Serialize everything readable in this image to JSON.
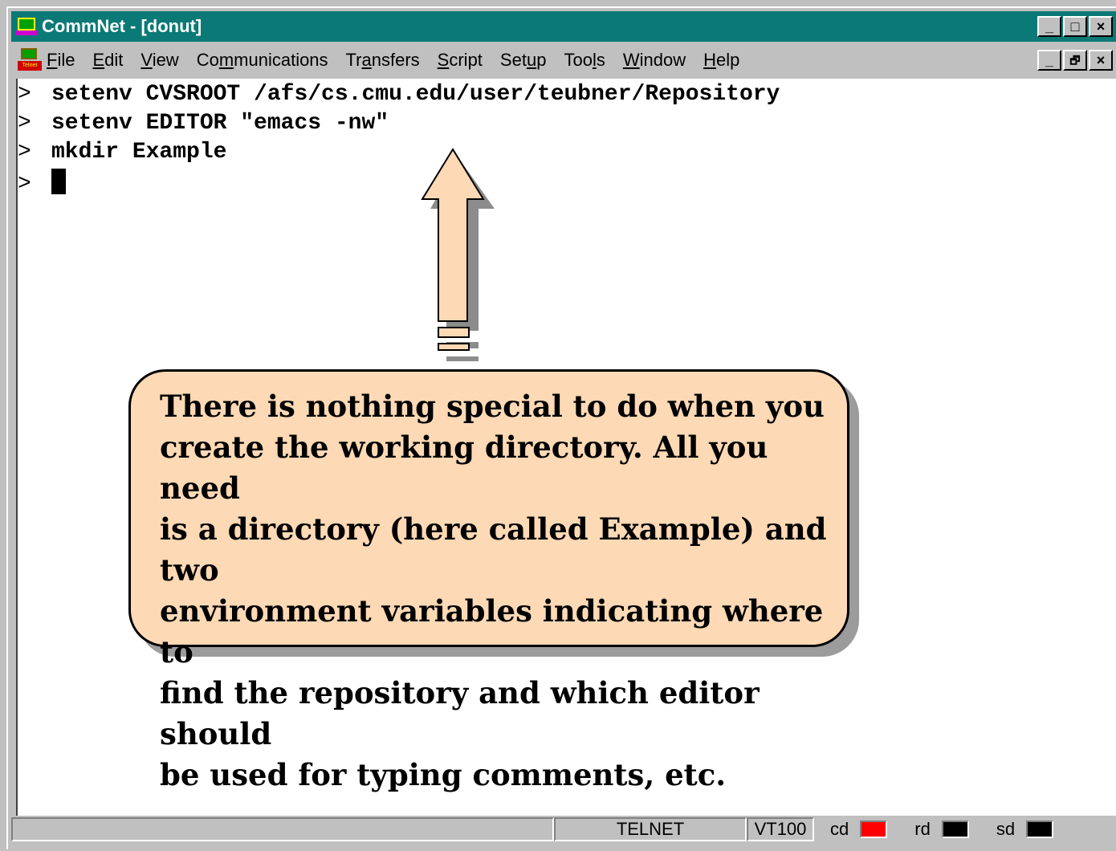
{
  "window": {
    "title": "CommNet - [donut]",
    "controls": {
      "minimize": "_",
      "maximize": "□",
      "close": "×",
      "restore": "🗗"
    }
  },
  "menu": {
    "items": [
      {
        "label": "File",
        "accel": "F",
        "rest": "ile"
      },
      {
        "label": "Edit",
        "accel": "E",
        "rest": "dit"
      },
      {
        "label": "View",
        "accel": "V",
        "rest": "iew"
      },
      {
        "label": "Communications",
        "pre": "Co",
        "accel": "m",
        "rest": "munications"
      },
      {
        "label": "Transfers",
        "pre": "Tr",
        "accel": "a",
        "rest": "nsfers"
      },
      {
        "label": "Script",
        "accel": "S",
        "rest": "cript"
      },
      {
        "label": "Setup",
        "pre": "Set",
        "accel": "u",
        "rest": "p"
      },
      {
        "label": "Tools",
        "pre": "Too",
        "accel": "l",
        "rest": "s"
      },
      {
        "label": "Window",
        "accel": "W",
        "rest": "indow"
      },
      {
        "label": "Help",
        "accel": "H",
        "rest": "elp"
      }
    ],
    "doc_icon_label": "Telnet"
  },
  "terminal": {
    "prompt": ">",
    "lines": [
      "setenv CVSROOT /afs/cs.cmu.edu/user/teubner/Repository",
      "setenv EDITOR \"emacs -nw\"",
      "mkdir Example",
      ""
    ]
  },
  "callout": {
    "lines": [
      "There is nothing special to do when you",
      "create the working directory. All you need",
      "is a directory (here called Example) and two",
      "environment variables indicating where to",
      "find the repository and which editor should",
      "be used for typing comments, etc."
    ]
  },
  "statusbar": {
    "protocol": "TELNET",
    "emulation": "VT100",
    "indicators": [
      {
        "label": "cd",
        "color": "#ff0000"
      },
      {
        "label": "rd",
        "color": "#000000"
      },
      {
        "label": "sd",
        "color": "#000000"
      }
    ]
  },
  "colors": {
    "titlebar": "#0b7a76",
    "callout_fill": "#fdd9b5",
    "arrow_fill": "#fdd9b5"
  }
}
